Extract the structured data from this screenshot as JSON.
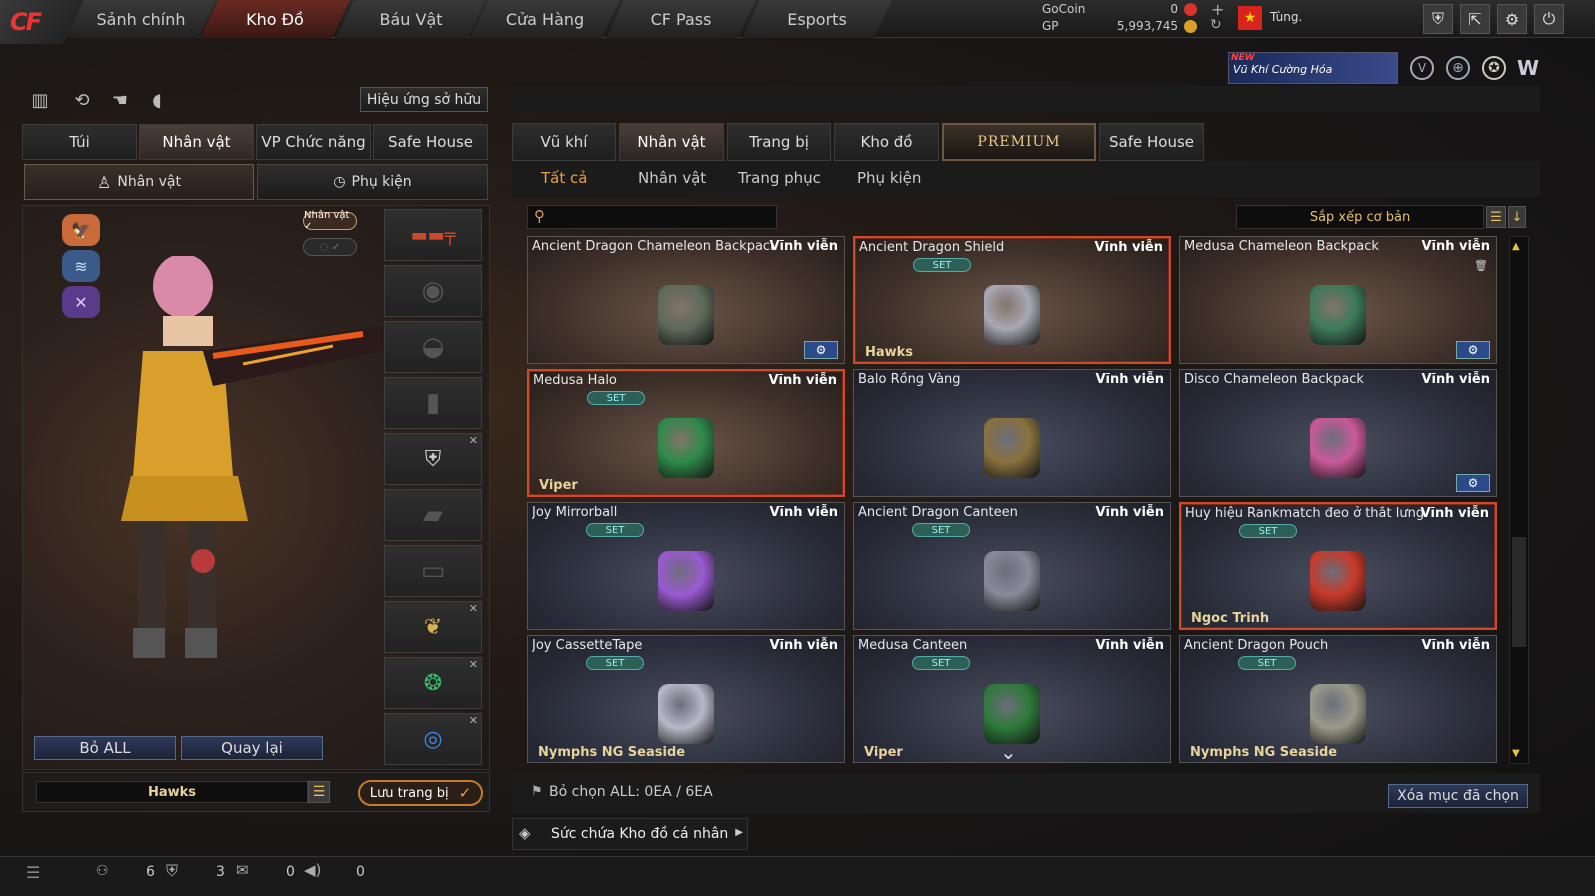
{
  "logo": "CF",
  "nav": [
    "Sảnh chính",
    "Kho Đồ",
    "Báu Vật",
    "Cửa Hàng",
    "CF Pass",
    "Esports"
  ],
  "nav_active": 1,
  "currency": {
    "gocoin_label": "GoCoin",
    "gocoin_value": "0",
    "gp_label": "GP",
    "gp_value": "5,993,745"
  },
  "user": {
    "name": "Tùng."
  },
  "banner": {
    "tag": "NEW",
    "text": "Vũ Khí Cường Hóa"
  },
  "left": {
    "effects_button": "Hiệu ứng sở hữu",
    "tabs": [
      "Túi",
      "Nhân vật",
      "VP Chức năng",
      "Safe House"
    ],
    "subtabs": [
      "Nhân vật",
      "Phụ kiện"
    ],
    "character_badge": "Nhân vật ✓",
    "remove_all": "Bỏ ALL",
    "back": "Quay lại",
    "team_name": "Hawks",
    "save_button": "Lưu trang bị"
  },
  "right": {
    "tabs": [
      "Vũ khí",
      "Nhân vật",
      "Trang bị",
      "Kho đồ",
      "PREMIUM",
      "Safe House"
    ],
    "subtabs": [
      "Tất cả",
      "Nhân vật",
      "Trang phục",
      "Phụ kiện"
    ],
    "search_placeholder": "",
    "sort_label": "Sắp xếp cơ bản",
    "deselect_text": "Bỏ chọn ALL: 0EA / 6EA",
    "delete_button": "Xóa mục đã chọn",
    "capacity_text": "Sức chứa Kho đồ cá nhân"
  },
  "items": [
    {
      "name": "Ancient Dragon Chameleon Backpack",
      "duration": "Vĩnh viễn",
      "set": "",
      "owner": "",
      "selected": false,
      "brown": true,
      "gear": true,
      "color": "#5e6a5a"
    },
    {
      "name": "Ancient Dragon Shield",
      "duration": "Vĩnh viễn",
      "set": "SET",
      "owner": "Hawks",
      "selected": true,
      "brown": true,
      "gear": false,
      "color": "#a8a8b4"
    },
    {
      "name": "Medusa Chameleon Backpack",
      "duration": "Vĩnh viễn",
      "set": "",
      "owner": "",
      "selected": false,
      "brown": true,
      "gear": true,
      "trash": true,
      "color": "#3e7a5a"
    },
    {
      "name": "Medusa Halo",
      "duration": "Vĩnh viễn",
      "set": "SET",
      "owner": "Viper",
      "selected": true,
      "brown": true,
      "gear": false,
      "color": "#2e8a4a"
    },
    {
      "name": "Balo Rồng Vàng",
      "duration": "Vĩnh viễn",
      "set": "",
      "owner": "",
      "selected": false,
      "brown": false,
      "gear": false,
      "color": "#8a7240"
    },
    {
      "name": "Disco Chameleon Backpack",
      "duration": "Vĩnh viễn",
      "set": "",
      "owner": "",
      "selected": false,
      "brown": false,
      "gear": true,
      "color": "#c85a9a"
    },
    {
      "name": "Joy Mirrorball",
      "duration": "Vĩnh viễn",
      "set": "SET",
      "owner": "",
      "selected": false,
      "brown": false,
      "gear": false,
      "color": "#9a5ad0"
    },
    {
      "name": "Ancient Dragon Canteen",
      "duration": "Vĩnh viễn",
      "set": "SET",
      "owner": "",
      "selected": false,
      "brown": false,
      "gear": false,
      "color": "#8a8a9a"
    },
    {
      "name": "Huy hiệu Rankmatch đeo ở thắt lưng",
      "duration": "Vĩnh viễn",
      "set": "SET",
      "owner": "Ngoc Trinh",
      "selected": true,
      "brown": false,
      "gear": false,
      "color": "#c83a2a"
    },
    {
      "name": "Joy CassetteTape",
      "duration": "Vĩnh viễn",
      "set": "SET",
      "owner": "Nymphs NG Seaside",
      "selected": false,
      "brown": false,
      "gear": false,
      "color": "#b8b8c8"
    },
    {
      "name": "Medusa Canteen",
      "duration": "Vĩnh viễn",
      "set": "SET",
      "owner": "Viper",
      "selected": false,
      "brown": false,
      "gear": false,
      "color": "#2e7a3a"
    },
    {
      "name": "Ancient Dragon Pouch",
      "duration": "Vĩnh viễn",
      "set": "SET",
      "owner": "Nymphs NG Seaside",
      "selected": false,
      "brown": false,
      "gear": false,
      "color": "#9a9a8a"
    }
  ],
  "status": {
    "a": "6",
    "b": "3",
    "c": "0",
    "d": "0"
  }
}
